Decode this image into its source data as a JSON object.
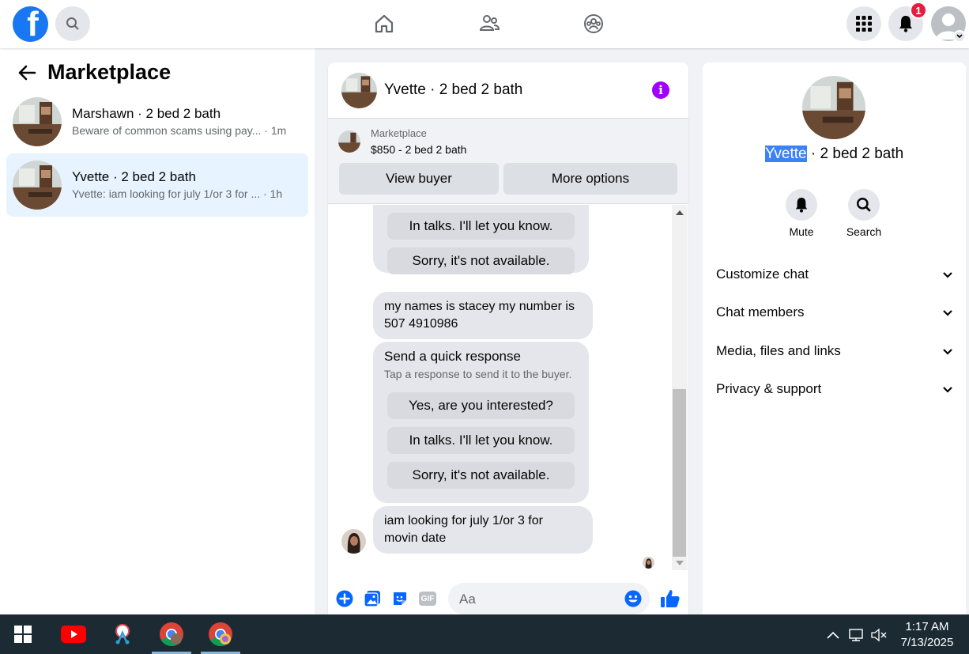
{
  "topbar": {
    "logo_letter": "f",
    "notification_count": "1"
  },
  "sidebar": {
    "title": "Marketplace",
    "conversations": [
      {
        "name": "Marshawn · 2 bed 2 bath",
        "preview": "Beware of common scams using pay...",
        "time": "· 1m",
        "active": false
      },
      {
        "name": "Yvette · 2 bed 2 bath",
        "preview": "Yvette: iam looking for july 1/or 3 for ...",
        "time": "· 1h",
        "active": true
      }
    ]
  },
  "chat": {
    "title": "Yvette · 2 bed 2 bath",
    "marketplace_label": "Marketplace",
    "listing": "$850 - 2 bed 2 bath",
    "view_buyer": "View buyer",
    "more_options": "More options",
    "messages": {
      "quick_top_1": "In talks. I'll let you know.",
      "quick_top_2": "Sorry, it's not available.",
      "msg1_line1": "my names is stacey my number is",
      "msg1_line2": "507 4910986",
      "quick_title": "Send a quick response",
      "quick_sub": "Tap a response to send it to the buyer.",
      "quick_1": "Yes, are you interested?",
      "quick_2": "In talks. I'll let you know.",
      "quick_3": "Sorry, it's not available.",
      "msg2_line1": "iam looking for july 1/or 3 for",
      "msg2_line2": "movin date"
    },
    "input_placeholder": "Aa",
    "gif_label": "GIF"
  },
  "details": {
    "name_selected": "Yvette",
    "name_rest": " · 2 bed 2 bath",
    "actions": {
      "mute": "Mute",
      "search": "Search"
    },
    "sections": [
      "Customize chat",
      "Chat members",
      "Media, files and links",
      "Privacy & support"
    ]
  },
  "taskbar": {
    "time": "1:17 AM",
    "date": "7/13/2025"
  },
  "colors": {
    "accent": "#1877f2",
    "info": "#a100ff",
    "badge": "#e41e3f",
    "taskbar": "#1c2b33"
  }
}
